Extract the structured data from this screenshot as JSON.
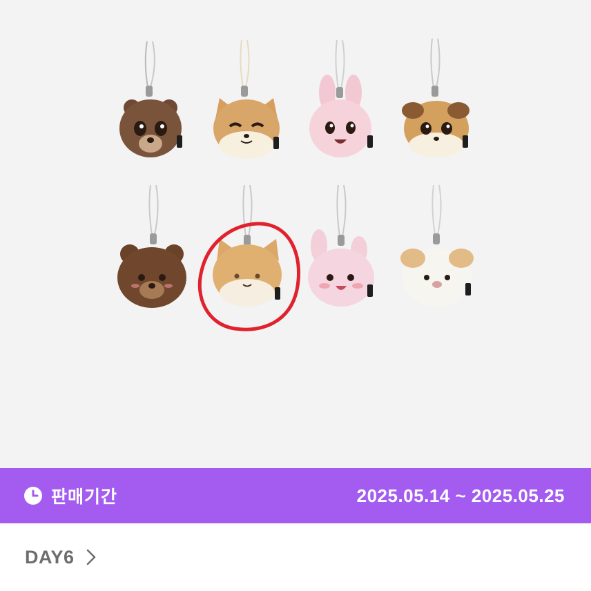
{
  "sale": {
    "label": "판매기간",
    "dates": "2025.05.14 ~ 2025.05.25",
    "icon": "clock-icon",
    "bar_color": "#a45cf0"
  },
  "artist": {
    "name": "DAY6",
    "icon": "chevron-right-icon"
  },
  "image": {
    "items": [
      "bear-keyring",
      "shiba-keyring",
      "bunny-keyring",
      "puppy-keyring",
      "fluffy-bear-keyring",
      "fluffy-shiba-keyring",
      "fluffy-bunny-keyring",
      "fluffy-puppy-keyring"
    ],
    "highlight": "fluffy-shiba-keyring",
    "highlight_color": "#e0222e"
  }
}
